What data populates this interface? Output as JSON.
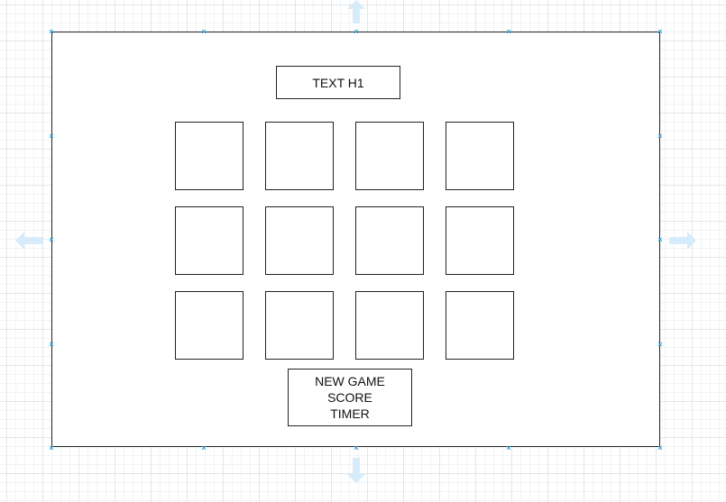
{
  "heading": {
    "text": "TEXT H1"
  },
  "board": {
    "rows": 3,
    "columns": 4
  },
  "controls": {
    "new_game": "NEW GAME",
    "score": "SCORE",
    "timer": "TIMER"
  },
  "colors": {
    "stroke": "#222222",
    "selection": "#29a3e6",
    "arrow": "#d6ecfa",
    "grid": "#e3e6ea"
  },
  "icons": {
    "selection_handle": "x-handle-icon",
    "expand_arrow": "arrow-icon"
  }
}
